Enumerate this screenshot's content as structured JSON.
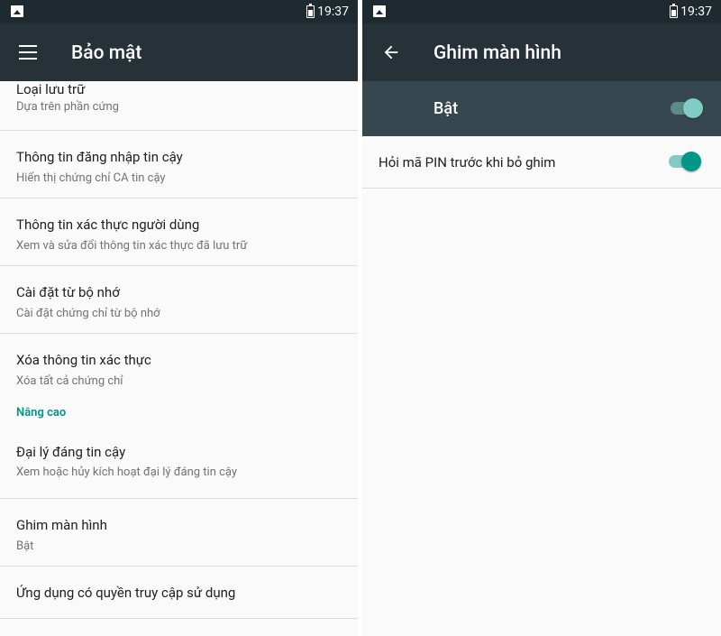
{
  "status_bar": {
    "time": "19:37"
  },
  "left": {
    "toolbar": {
      "title": "Bảo mật"
    },
    "items": [
      {
        "title": "Loại lưu trữ",
        "summary": "Dựa trên phần cứng"
      },
      {
        "title": "Thông tin đăng nhập tin cậy",
        "summary": "Hiển thị chứng chỉ CA tin cậy"
      },
      {
        "title": "Thông tin xác thực người dùng",
        "summary": "Xem và sửa đổi thông tin xác thực đã lưu trữ"
      },
      {
        "title": "Cài đặt từ bộ nhớ",
        "summary": "Cài đặt chứng chỉ từ bộ nhớ"
      },
      {
        "title": "Xóa thông tin xác thực",
        "summary": "Xóa tất cả chứng chỉ"
      }
    ],
    "category": "Nâng cao",
    "advanced_items": [
      {
        "title": "Đại lý đáng tin cậy",
        "summary": "Xem hoặc hủy kích hoạt đại lý đáng tin cậy"
      },
      {
        "title": "Ghim màn hình",
        "summary": "Bật"
      },
      {
        "title": "Ứng dụng có quyền truy cập sử dụng",
        "summary": ""
      }
    ]
  },
  "right": {
    "toolbar": {
      "title": "Ghim màn hình"
    },
    "master_switch": {
      "label": "Bật",
      "checked": true
    },
    "pin_option": {
      "label": "Hỏi mã PIN trước khi bỏ ghim",
      "checked": true
    }
  },
  "colors": {
    "statusbar": "#1e2a30",
    "toolbar": "#263238",
    "master_bar": "#37474f",
    "accent": "#009688",
    "accent_light": "#80cbc4"
  }
}
